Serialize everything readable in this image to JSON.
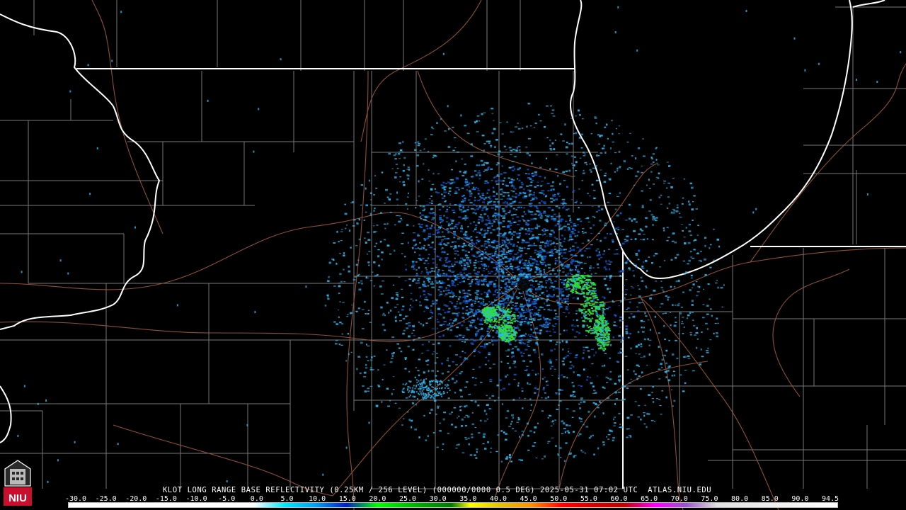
{
  "radar": {
    "caption": "KLOT LONG RANGE BASE REFLECTIVITY (0.25KM / 256 LEVEL) (000000/0000 0.5 DEG) 2025-05-31 07:02 UTC  ATLAS.NIU.EDU",
    "scale_values": [
      "-30.0",
      "-25.0",
      "-20.0",
      "-15.0",
      "-10.0",
      "-5.0",
      "0.0",
      "5.0",
      "10.0",
      "15.0",
      "20.0",
      "25.0",
      "30.0",
      "35.0",
      "40.0",
      "45.0",
      "50.0",
      "55.0",
      "60.0",
      "65.0",
      "70.0",
      "75.0",
      "80.0",
      "85.0",
      "90.0",
      "94.5"
    ],
    "colorbar_stops": [
      {
        "value": -30,
        "color": "#ffffff"
      },
      {
        "value": 0,
        "color": "#ffffff"
      },
      {
        "value": 5,
        "color": "#00e8ff"
      },
      {
        "value": 10,
        "color": "#00a0f0"
      },
      {
        "value": 15,
        "color": "#0020c0"
      },
      {
        "value": 20,
        "color": "#00ff00"
      },
      {
        "value": 27,
        "color": "#00a800"
      },
      {
        "value": 32,
        "color": "#007a00"
      },
      {
        "value": 35,
        "color": "#ffff00"
      },
      {
        "value": 40,
        "color": "#e8c000"
      },
      {
        "value": 45,
        "color": "#ff9000"
      },
      {
        "value": 50,
        "color": "#ff0000"
      },
      {
        "value": 55,
        "color": "#d40000"
      },
      {
        "value": 60,
        "color": "#c00000"
      },
      {
        "value": 65,
        "color": "#ff00ff"
      },
      {
        "value": 70,
        "color": "#9955c9"
      },
      {
        "value": 75,
        "color": "#e0e0e0"
      },
      {
        "value": 94.5,
        "color": "#ffffff"
      }
    ]
  },
  "logo": {
    "text": "NIU",
    "name": "niu-logo"
  },
  "colors": {
    "state_border": "#ffffff",
    "county_line": "#8c8c8c",
    "road": "#a0583c",
    "light_echo": "#30b8f0",
    "medium_echo": "#1060e0",
    "strong_echo": "#30e030"
  }
}
